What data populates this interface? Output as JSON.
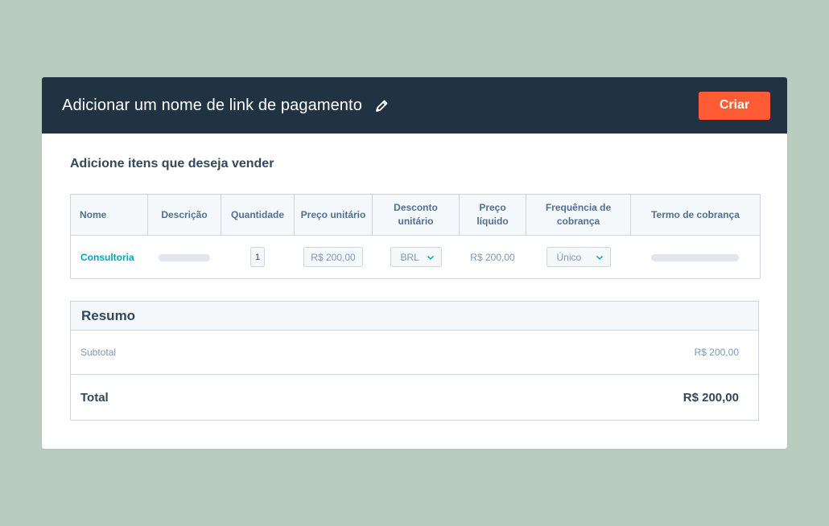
{
  "header": {
    "title": "Adicionar um nome de link de pagamento",
    "create_label": "Criar"
  },
  "section": {
    "title": "Adicione itens que deseja vender"
  },
  "table": {
    "columns": [
      "Nome",
      "Descrição",
      "Quantidade",
      "Preço unitário",
      "Desconto unitário",
      "Preço líquido",
      "Frequência de cobrança",
      "Termo de cobrança"
    ],
    "rows": [
      {
        "name": "Consultoria",
        "quantity": "1",
        "unit_price": "R$ 200,00",
        "discount_currency": "BRL",
        "net_price": "R$ 200,00",
        "frequency": "Único"
      }
    ]
  },
  "summary": {
    "title": "Resumo",
    "subtotal_label": "Subtotal",
    "subtotal_value": "R$ 200,00",
    "total_label": "Total",
    "total_value": "R$ 200,00"
  },
  "colors": {
    "background": "#b8cdbf",
    "header": "#213343",
    "accent": "#ff5c35",
    "link": "#00a4bd"
  },
  "icons": [
    "pencil-icon",
    "chevron-down-icon"
  ]
}
